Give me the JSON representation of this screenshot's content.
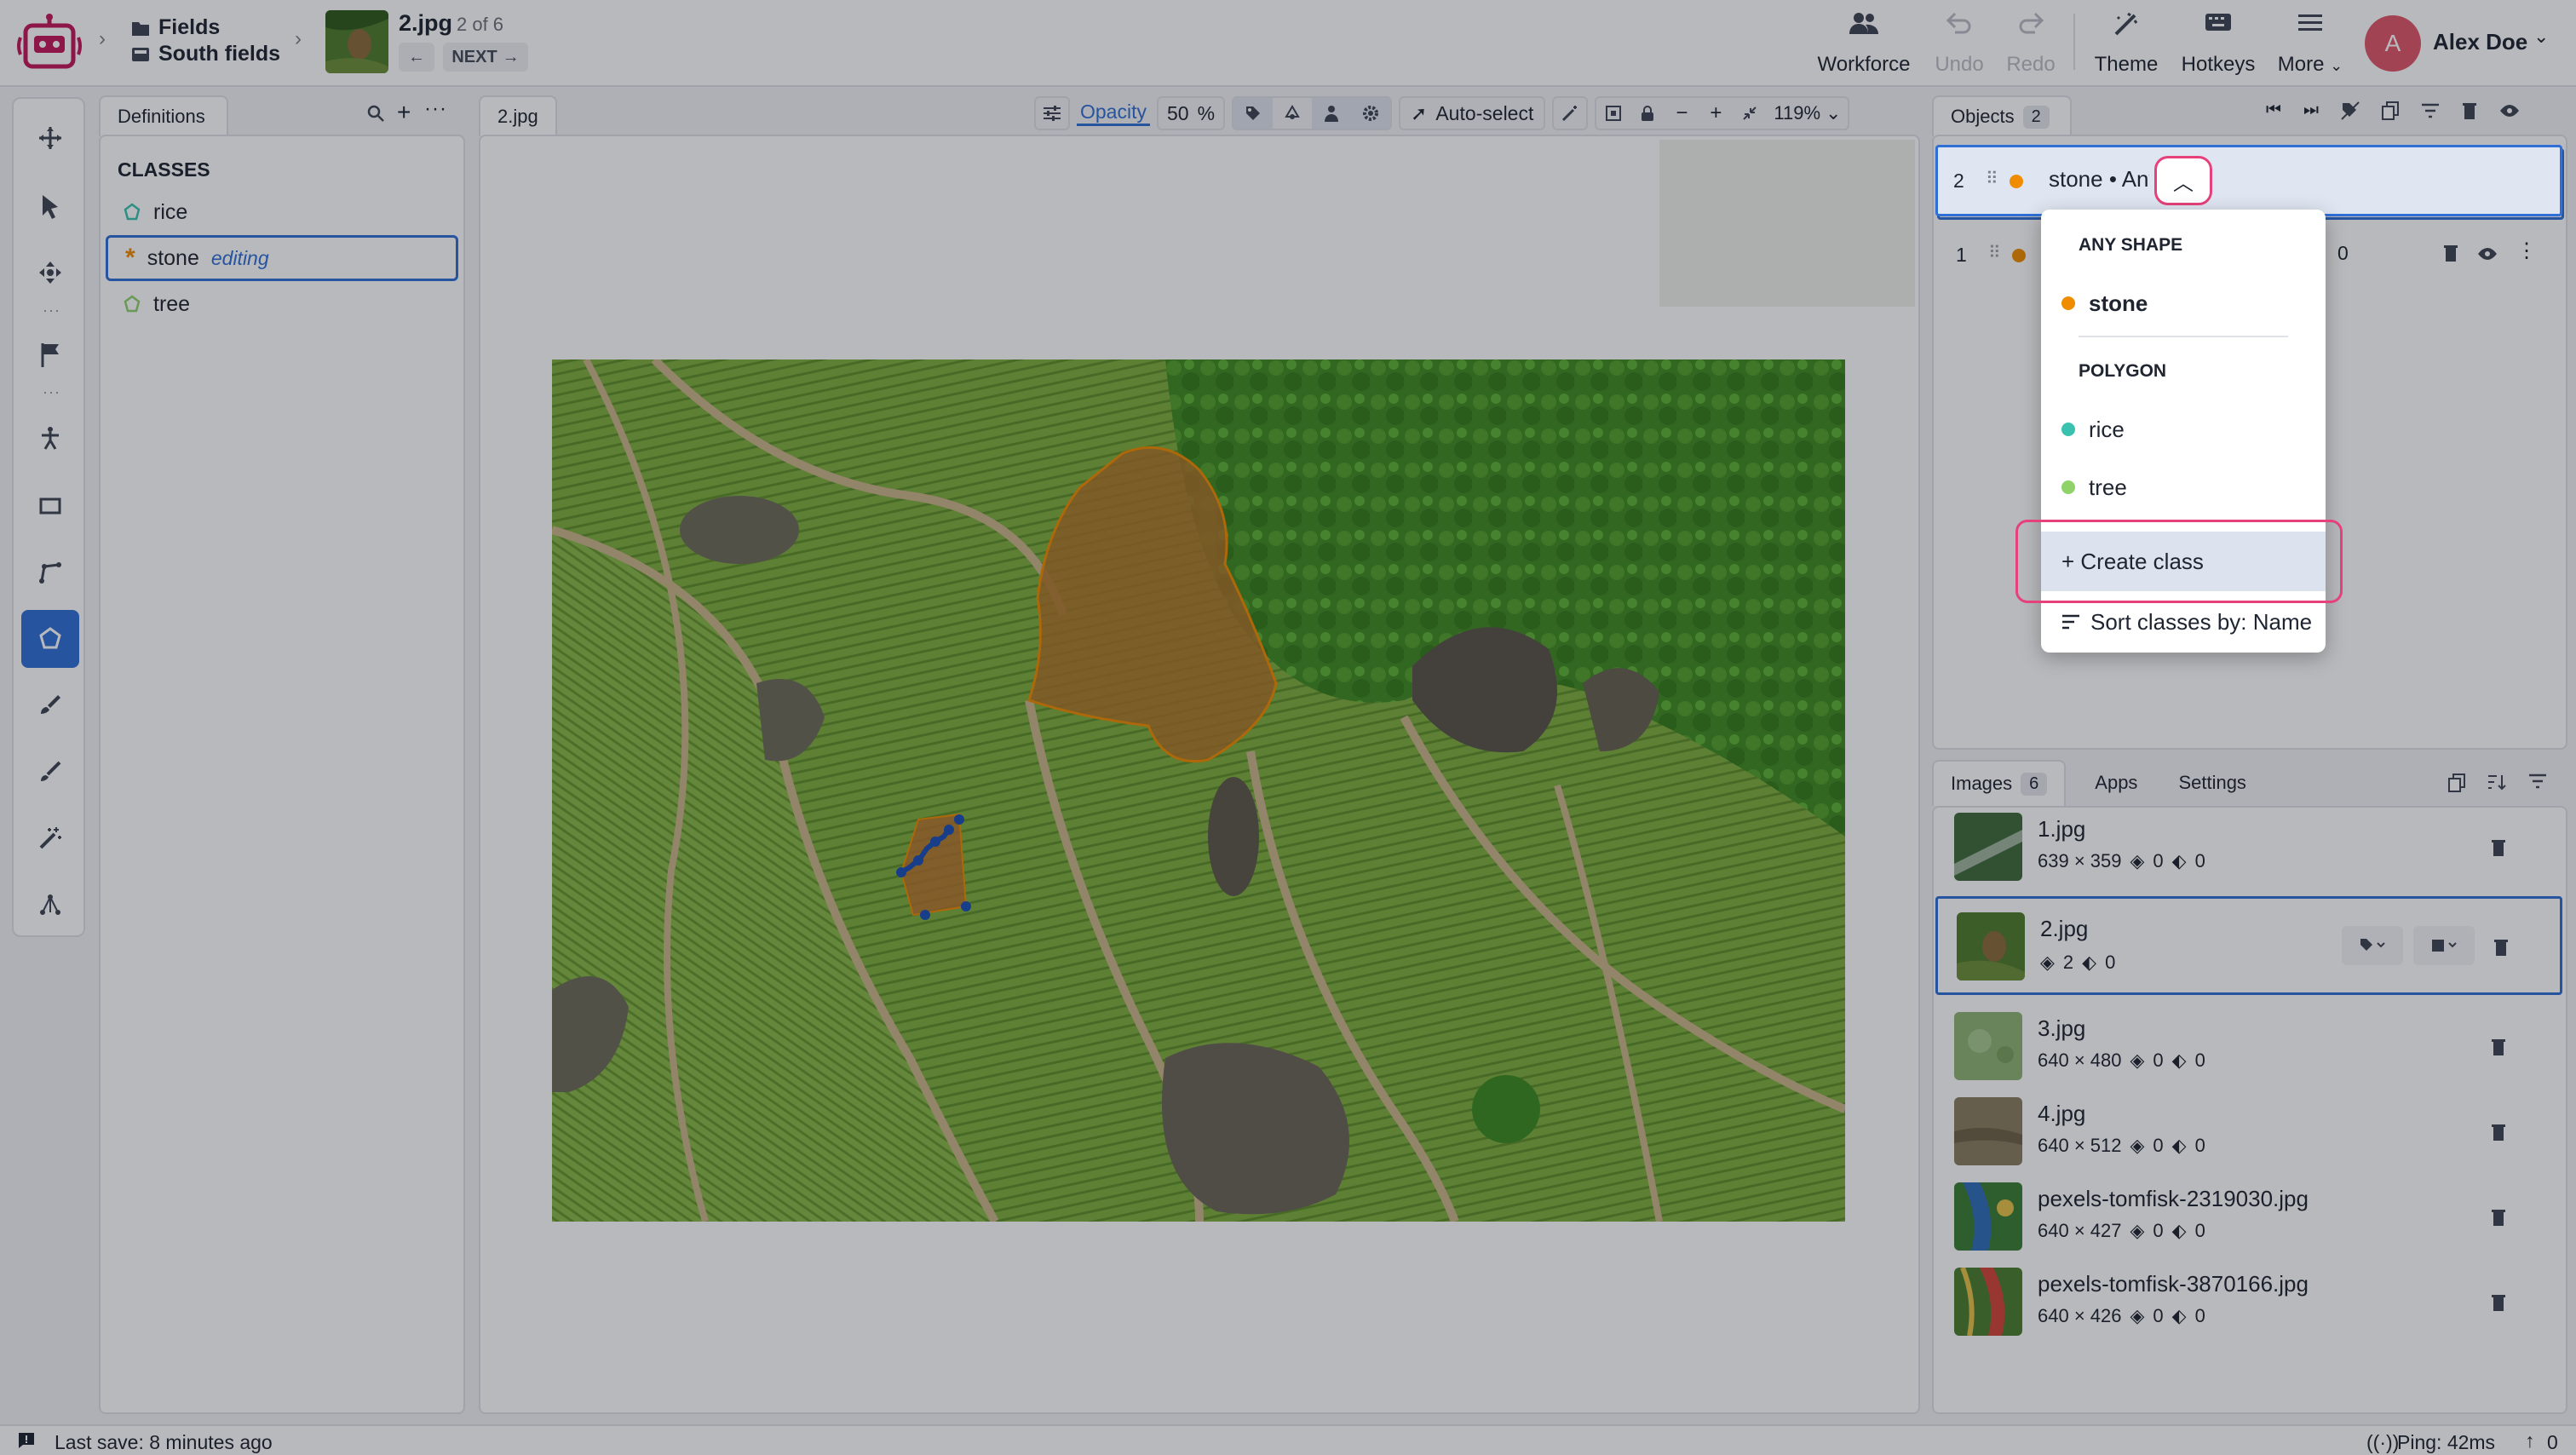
{
  "app": {
    "user_initial": "A",
    "user_name": "Alex Doe"
  },
  "breadcrumb": {
    "project": "Fields",
    "dataset": "South fields"
  },
  "image_nav": {
    "file": "2.jpg",
    "position": "2 of 6",
    "next_label": "NEXT"
  },
  "toolbar": {
    "workforce": "Workforce",
    "undo": "Undo",
    "redo": "Redo",
    "theme": "Theme",
    "hotkeys": "Hotkeys",
    "more": "More"
  },
  "definitions": {
    "tab_label": "Definitions",
    "heading": "CLASSES",
    "classes": [
      {
        "name": "rice",
        "color": "#39c2b0",
        "status": ""
      },
      {
        "name": "stone",
        "color": "#f08c00",
        "status": "editing"
      },
      {
        "name": "tree",
        "color": "#8fd26a",
        "status": ""
      }
    ]
  },
  "canvas": {
    "tab_label": "2.jpg",
    "opacity_label": "Opacity",
    "opacity_value": "50",
    "opacity_unit": "%",
    "auto_select": "Auto-select",
    "zoom": "119%"
  },
  "objects": {
    "tab_label": "Objects",
    "count": "2",
    "rows": [
      {
        "index": "2",
        "label": "stone • Any",
        "color": "#f08c00"
      },
      {
        "index": "1",
        "label": "",
        "color": "#f08c00",
        "tag_count": "0"
      }
    ]
  },
  "class_dropdown": {
    "section_any": "ANY SHAPE",
    "any_items": [
      {
        "name": "stone",
        "color": "#f08c00"
      }
    ],
    "section_polygon": "POLYGON",
    "polygon_items": [
      {
        "name": "rice",
        "color": "#39c2b0"
      },
      {
        "name": "tree",
        "color": "#8fd26a"
      }
    ],
    "create_label": "+ Create class",
    "sort_label": "Sort classes by: Name"
  },
  "images_panel": {
    "tabs": {
      "images": "Images",
      "images_count": "6",
      "apps": "Apps",
      "settings": "Settings"
    },
    "items": [
      {
        "name": "1.jpg",
        "dims": "639 × 359",
        "objects": "0",
        "tags": "0"
      },
      {
        "name": "2.jpg",
        "dims": "",
        "objects": "2",
        "tags": "0"
      },
      {
        "name": "3.jpg",
        "dims": "640 × 480",
        "objects": "0",
        "tags": "0"
      },
      {
        "name": "4.jpg",
        "dims": "640 × 512",
        "objects": "0",
        "tags": "0"
      },
      {
        "name": "pexels-tomfisk-2319030.jpg",
        "dims": "640 × 427",
        "objects": "0",
        "tags": "0"
      },
      {
        "name": "pexels-tomfisk-3870166.jpg",
        "dims": "640 × 426",
        "objects": "0",
        "tags": "0"
      }
    ]
  },
  "status": {
    "last_save": "Last save: 8 minutes ago",
    "ping": "Ping: 42ms",
    "uploads": "0"
  },
  "colors": {
    "accent": "#2f6fd6",
    "highlight": "#e6417a",
    "stone": "#f08c00"
  }
}
